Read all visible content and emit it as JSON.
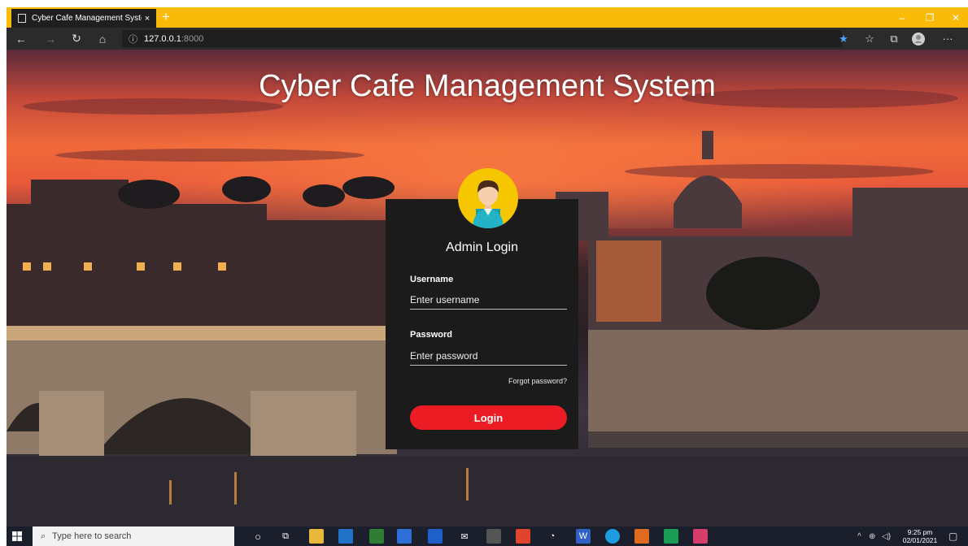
{
  "browser": {
    "tab_title": "Cyber Cafe Management System",
    "tab_close": "×",
    "new_tab": "+",
    "window_controls": {
      "minimize": "–",
      "restore": "❐",
      "close": "✕"
    },
    "nav": {
      "back": "←",
      "forward": "→",
      "refresh": "↻",
      "home": "⌂"
    },
    "url_info_icon": "ⓘ",
    "url_host": "127.0.0.1",
    "url_port": ":8000",
    "toolbar_icons": [
      "star-icon",
      "favorites-icon",
      "collections-icon",
      "profile-icon",
      "more-icon"
    ],
    "more_label": "···",
    "theme_color": "#f9bb07"
  },
  "page": {
    "title": "Cyber Cafe Management System",
    "login": {
      "heading": "Admin Login",
      "username_label": "Username",
      "username_placeholder": "Enter username",
      "password_label": "Password",
      "password_placeholder": "Enter password",
      "forgot_password": "Forgot password?",
      "login_button": "Login",
      "button_color": "#ec1c24",
      "card_color": "#1b1b1b",
      "avatar_color": "#f6c600"
    }
  },
  "taskbar": {
    "search_placeholder": "Type here to search",
    "tray_chevron": "^",
    "clock_time": "9:25 pm",
    "clock_date": "02/01/2021",
    "apps": [
      "cortana-icon",
      "task-view-icon",
      "file-explorer-icon",
      "outlook-icon",
      "sublime-icon",
      "store-icon",
      "dropbox-icon",
      "mail-icon",
      "calculator-icon",
      "brave-icon",
      "xampp-icon",
      "word-icon",
      "edge-icon",
      "media-player-icon",
      "pycharm-icon",
      "app-icon"
    ]
  }
}
